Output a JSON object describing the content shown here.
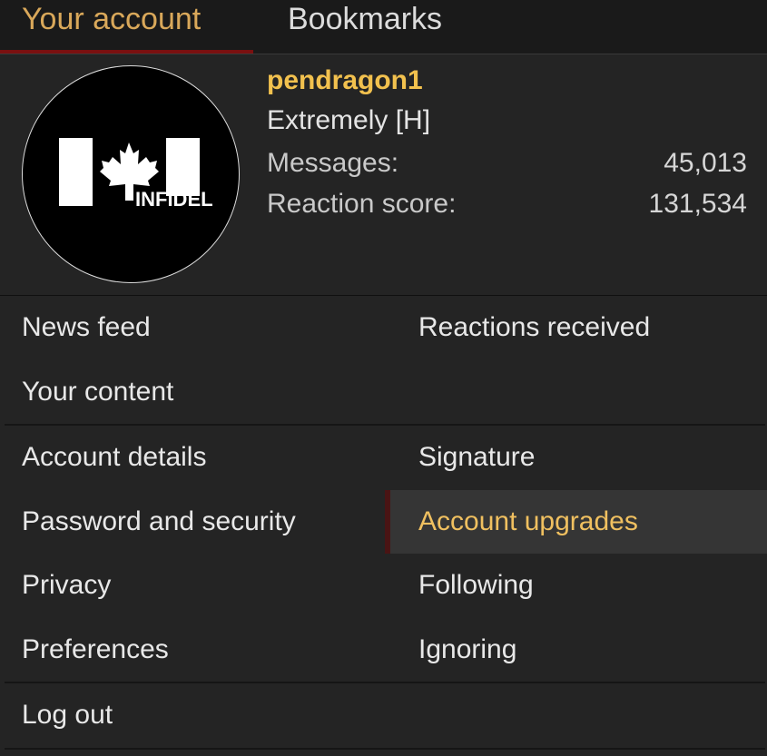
{
  "tabs": {
    "account": "Your account",
    "bookmarks": "Bookmarks"
  },
  "profile": {
    "username": "pendragon1",
    "user_title": "Extremely [H]",
    "avatar_text": "INFIDEL",
    "stats": [
      {
        "label": "Messages:",
        "value": "45,013"
      },
      {
        "label": "Reaction score:",
        "value": "131,534"
      }
    ]
  },
  "menu": {
    "group1": {
      "news_feed": "News feed",
      "reactions_received": "Reactions received",
      "your_content": "Your content"
    },
    "group2": {
      "account_details": "Account details",
      "signature": "Signature",
      "password_security": "Password and security",
      "account_upgrades": "Account upgrades",
      "privacy": "Privacy",
      "following": "Following",
      "preferences": "Preferences",
      "ignoring": "Ignoring"
    },
    "log_out": "Log out"
  },
  "colors": {
    "accent": "#f2c14e",
    "active_tab": "#d9a85a",
    "active_underline": "#7a1010",
    "background": "#242424"
  }
}
